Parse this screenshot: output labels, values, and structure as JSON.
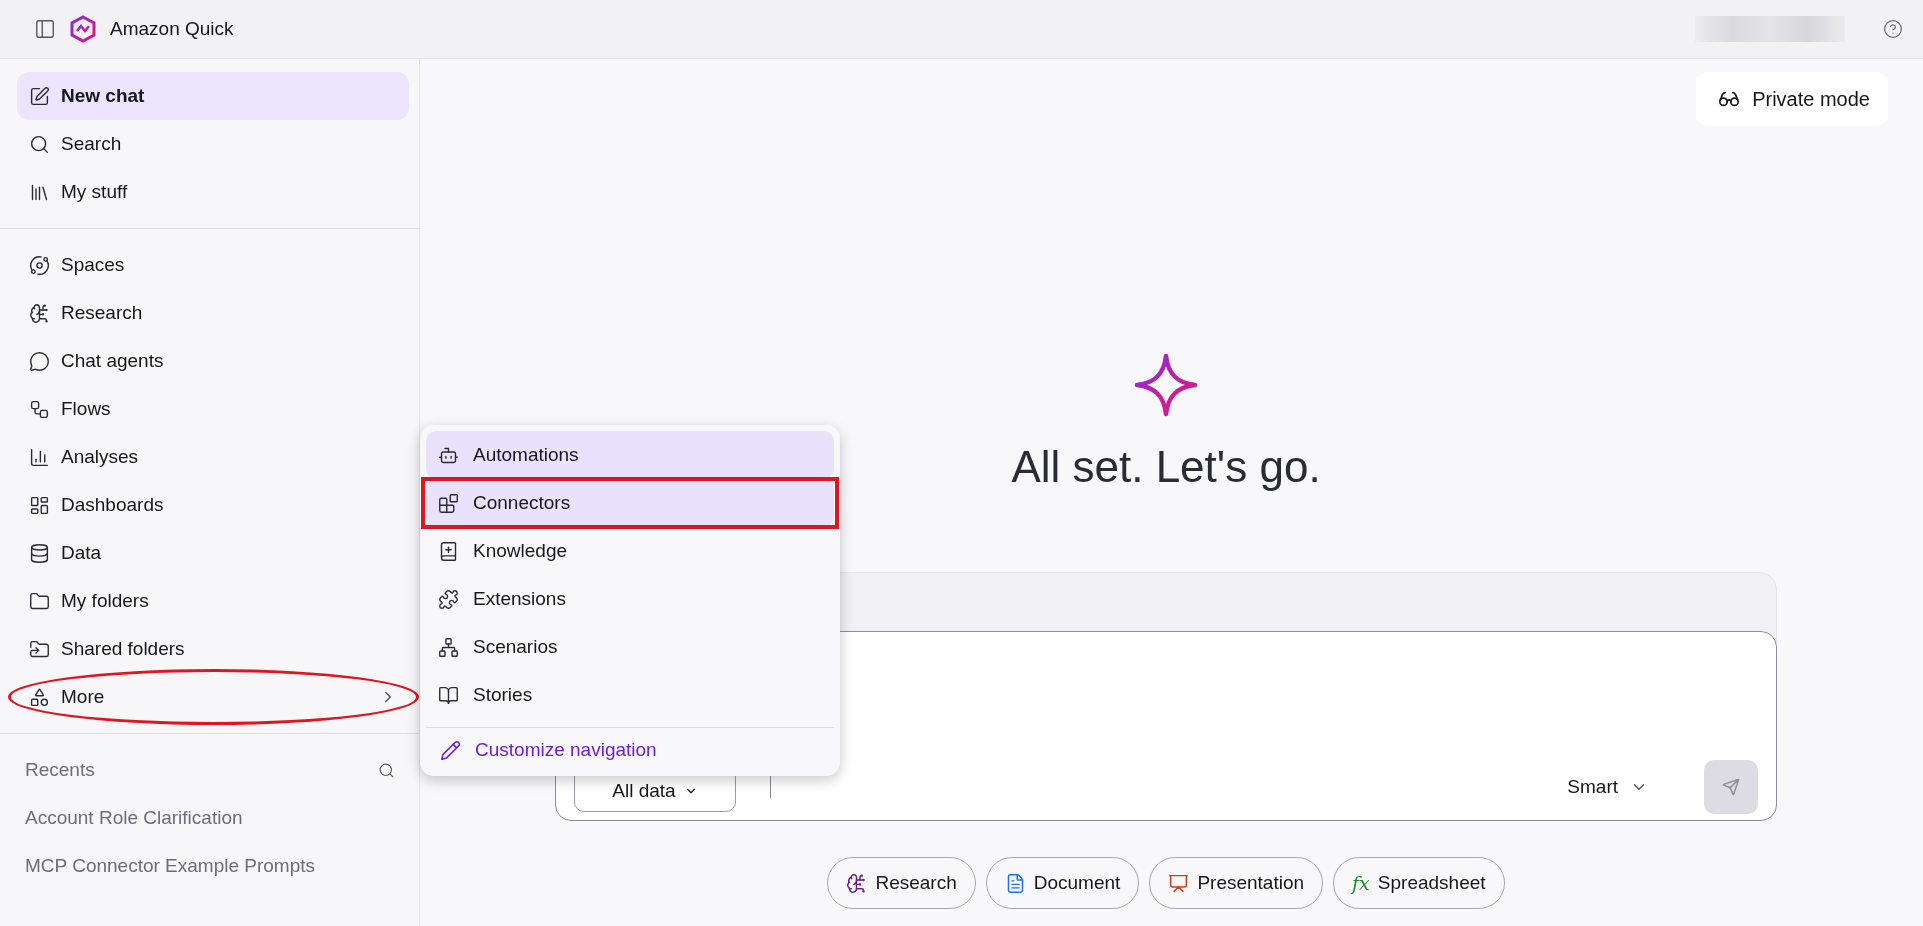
{
  "app": {
    "title": "Amazon Quick"
  },
  "sidebar": {
    "primary": [
      {
        "label": "New chat",
        "selected": true
      },
      {
        "label": "Search",
        "selected": false
      },
      {
        "label": "My stuff",
        "selected": false
      }
    ],
    "nav": [
      {
        "label": "Spaces",
        "selected": false
      },
      {
        "label": "Research",
        "selected": false
      },
      {
        "label": "Chat agents",
        "selected": false
      },
      {
        "label": "Flows",
        "selected": false
      },
      {
        "label": "Analyses",
        "selected": false
      },
      {
        "label": "Dashboards",
        "selected": false
      },
      {
        "label": "Data",
        "selected": false
      },
      {
        "label": "My folders",
        "selected": false
      },
      {
        "label": "Shared folders",
        "selected": false
      }
    ],
    "more": {
      "label": "More",
      "expanded": true,
      "annotated": true
    },
    "recents": {
      "title": "Recents",
      "items": [
        "Account Role Clarification",
        "MCP Connector Example Prompts"
      ]
    }
  },
  "more_menu": {
    "items": [
      {
        "label": "Automations",
        "selected": true,
        "annotated": false
      },
      {
        "label": "Connectors",
        "selected": true,
        "annotated": true
      },
      {
        "label": "Knowledge",
        "selected": false,
        "annotated": false
      },
      {
        "label": "Extensions",
        "selected": false,
        "annotated": false
      },
      {
        "label": "Scenarios",
        "selected": false,
        "annotated": false
      },
      {
        "label": "Stories",
        "selected": false,
        "annotated": false
      }
    ],
    "footer": "Customize navigation"
  },
  "main": {
    "private_mode": "Private mode",
    "heading": "All set. Let's go.",
    "composer": {
      "source": "All data",
      "model": "Smart"
    },
    "shortcuts": [
      {
        "label": "Research"
      },
      {
        "label": "Document"
      },
      {
        "label": "Presentation"
      },
      {
        "label": "Spreadsheet",
        "glyph": "fx"
      }
    ]
  }
}
